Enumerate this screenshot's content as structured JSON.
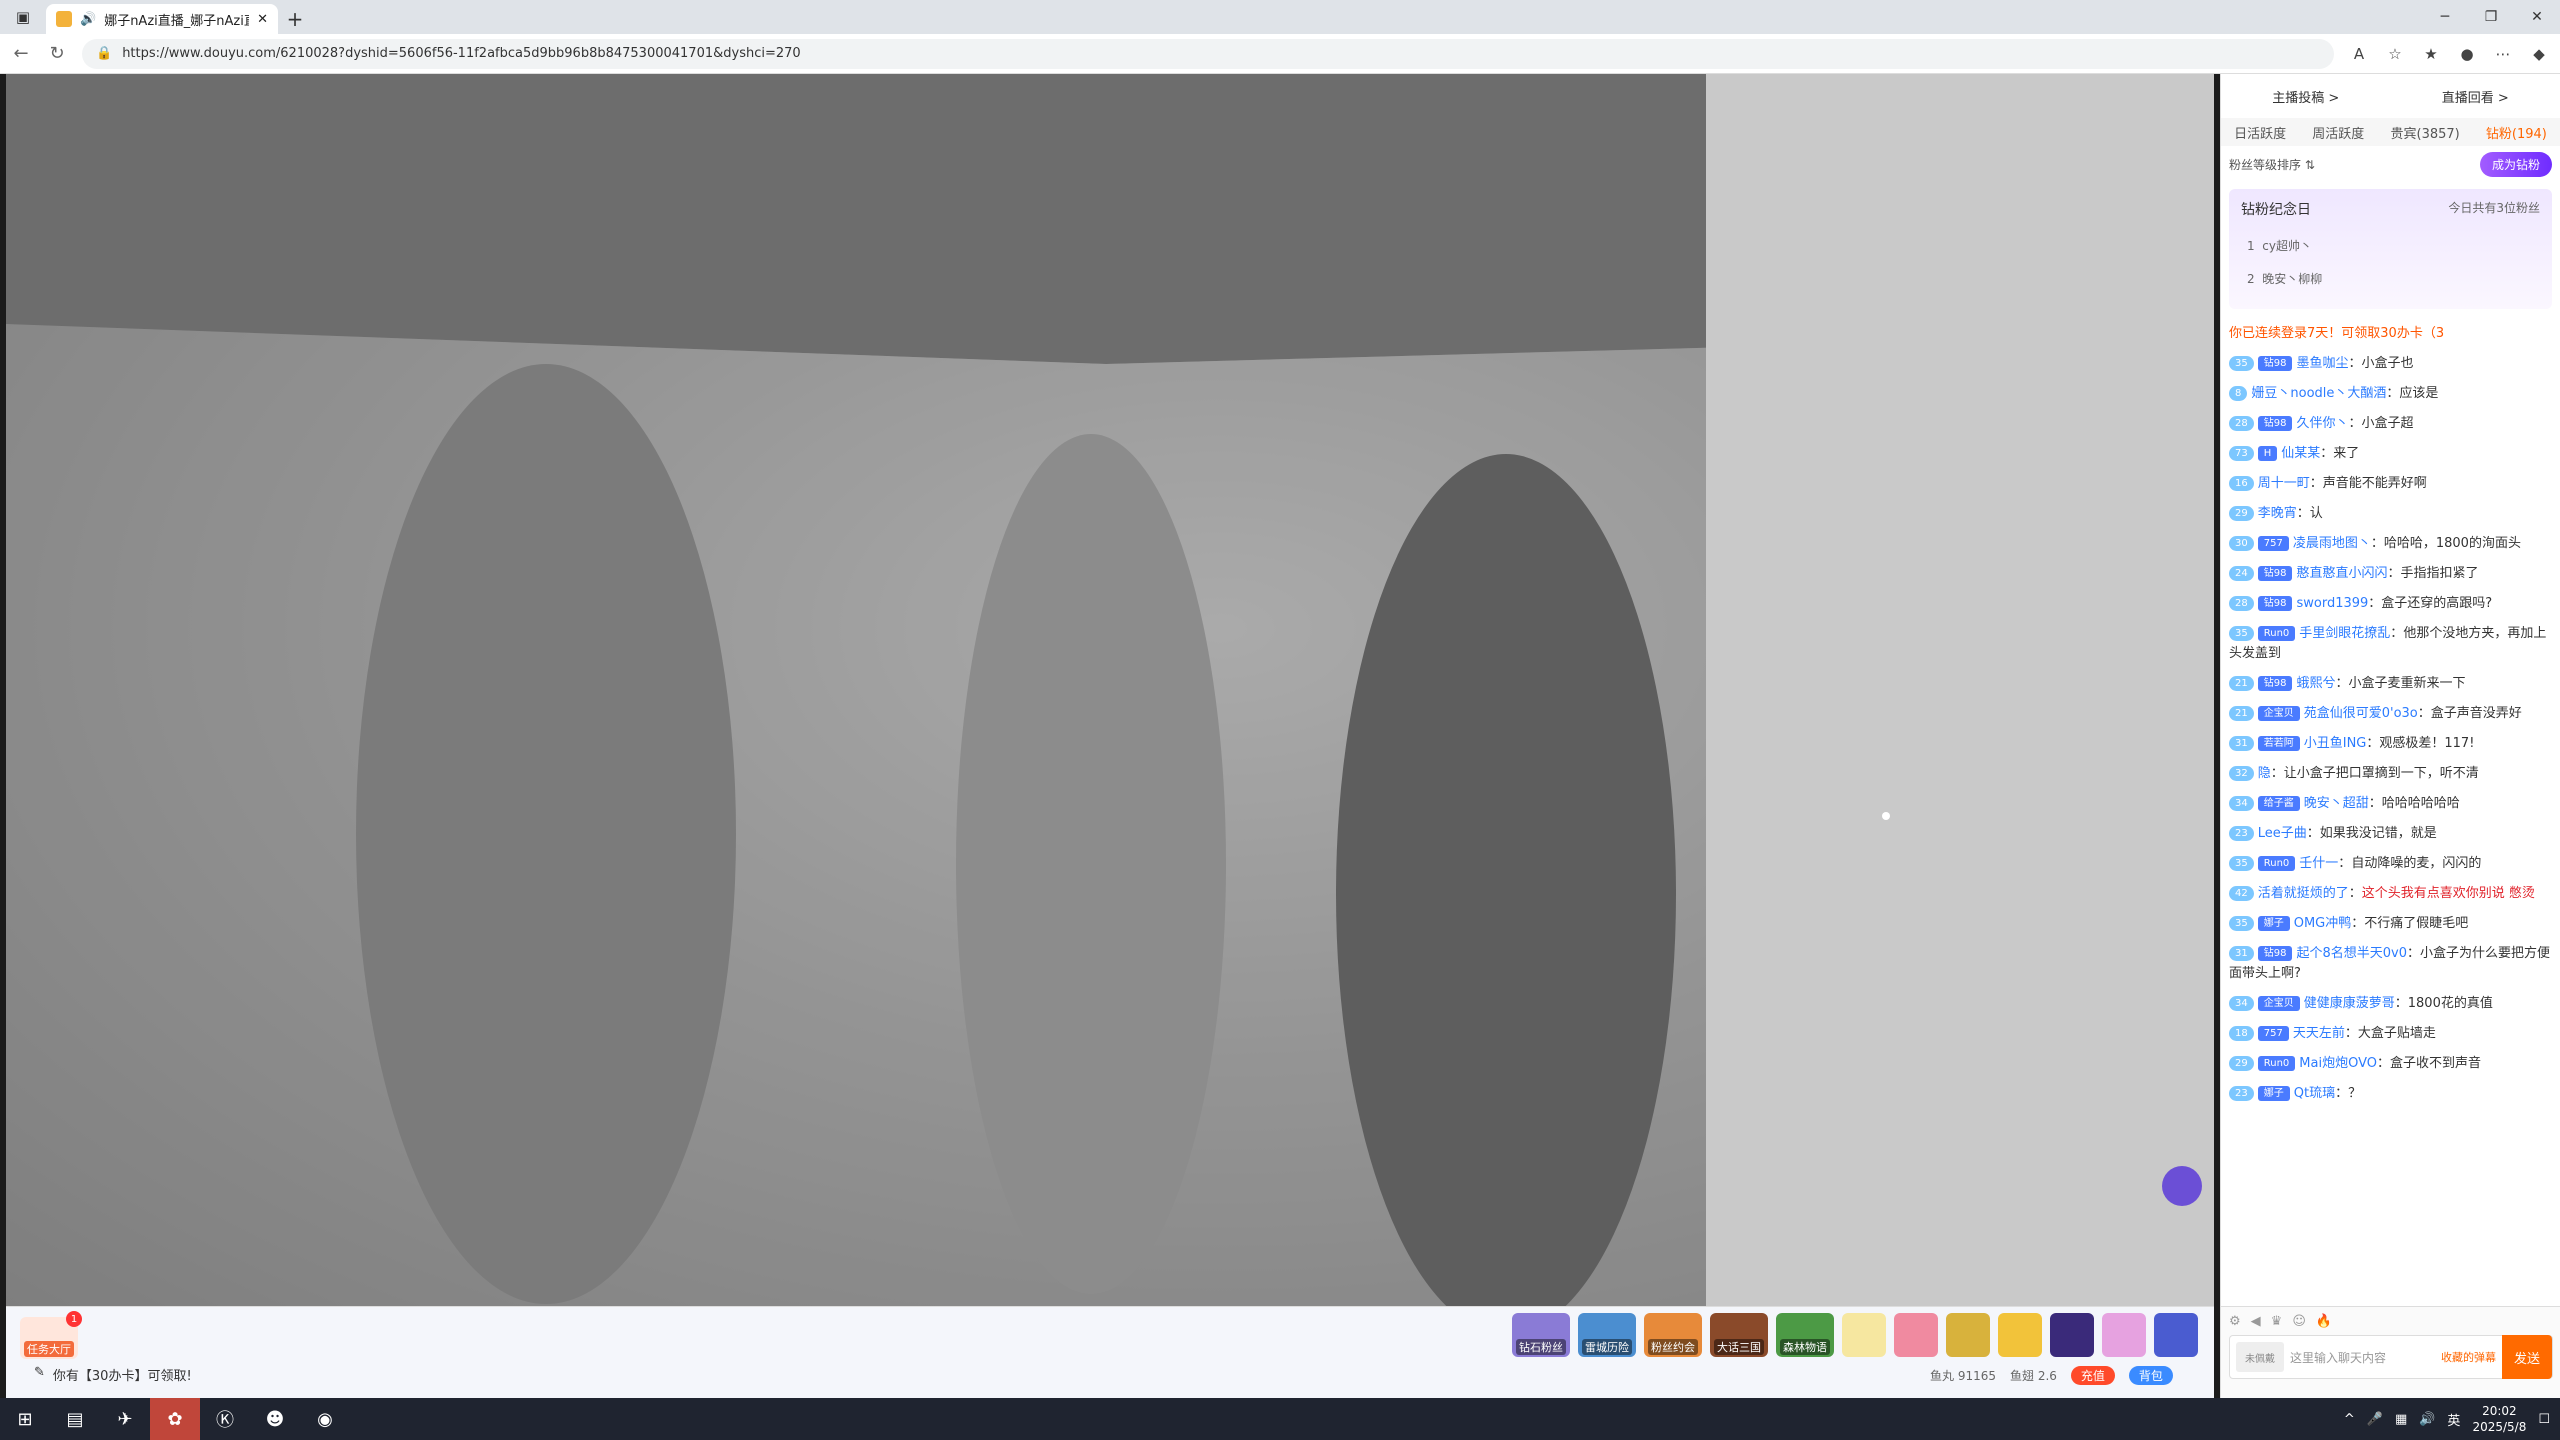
{
  "browser": {
    "tab_title": "娜子nAzi直播_娜子nAzi直播",
    "url": "https://www.douyu.com/6210028?dyshid=5606f56-11f2afbca5d9bb96b8b8475300041701&dyshci=270"
  },
  "aside": {
    "top_links": [
      "主播投稿 >",
      "直播回看 >"
    ],
    "tabs": [
      "日活跃度",
      "周活跃度",
      "贵宾(3857)",
      "钻粉(194)"
    ],
    "sort_label": "粉丝等级排序 ⇅",
    "vip_button": "成为钻粉",
    "anniv_title": "钻粉纪念日",
    "anniv_count": "今日共有3位粉丝",
    "rank": [
      {
        "n": "1",
        "name": "cy超帅丶"
      },
      {
        "n": "2",
        "name": "晚安丶柳柳"
      }
    ]
  },
  "chat": {
    "system": "你已连续登录7天！可领取30办卡（3",
    "messages": [
      {
        "lv": "35",
        "fan": "钻98",
        "name": "墨鱼咖尘",
        "text": "小盒子也"
      },
      {
        "lv": "8",
        "fan": "",
        "name": "姗豆丶noodle丶大酗酒",
        "text": "应该是"
      },
      {
        "lv": "28",
        "fan": "钻98",
        "name": "久伴你丶",
        "text": "小盒子超"
      },
      {
        "lv": "73",
        "fan": "H",
        "name": "仙某某",
        "text": "来了"
      },
      {
        "lv": "16",
        "fan": "",
        "name": "周十一町",
        "text": "声音能不能弄好啊"
      },
      {
        "lv": "29",
        "fan": "",
        "name": "李晚宵",
        "text": "认"
      },
      {
        "lv": "30",
        "fan": "757",
        "name": "凌晨雨地图丶",
        "text": "哈哈哈，1800的洵面头"
      },
      {
        "lv": "24",
        "fan": "钻98",
        "name": "憨直憨直小闪闪",
        "text": "手指指扣紧了"
      },
      {
        "lv": "28",
        "fan": "钻98",
        "name": "sword1399",
        "text": "盒子还穿的高跟吗?"
      },
      {
        "lv": "35",
        "fan": "Run0",
        "name": "手里剑眼花撩乱",
        "text": "他那个没地方夹，再加上头发盖到"
      },
      {
        "lv": "21",
        "fan": "钻98",
        "name": "蛾熙兮",
        "text": "小盒子麦重新来一下"
      },
      {
        "lv": "21",
        "fan": "企宝贝",
        "name": "苑盒仙很可爱0'o3o",
        "text": "盒子声音没弄好"
      },
      {
        "lv": "31",
        "fan": "若若阿",
        "name": "小丑鱼ING",
        "text": "观感极差！117!"
      },
      {
        "lv": "32",
        "fan": "",
        "name": "隐",
        "text": "让小盒子把口罩摘到一下，听不清"
      },
      {
        "lv": "34",
        "fan": "给子酱",
        "name": "晚安丶超甜",
        "text": "哈哈哈哈哈哈"
      },
      {
        "lv": "23",
        "fan": "",
        "name": "Lee子曲",
        "text": "如果我没记错，就是"
      },
      {
        "lv": "35",
        "fan": "Run0",
        "name": "壬什一",
        "text": "自动降噪的麦，闪闪的"
      },
      {
        "lv": "42",
        "fan": "",
        "name": "活着就挺烦的了",
        "text": "这个头我有点喜欢你别说 憋烫",
        "red": true
      },
      {
        "lv": "35",
        "fan": "娜子",
        "name": "OMG冲鸭",
        "text": "不行痛了假睫毛吧"
      },
      {
        "lv": "31",
        "fan": "钻98",
        "name": "起个8名想半天0v0",
        "text": "小盒子为什么要把方便面带头上啊?"
      },
      {
        "lv": "34",
        "fan": "企宝贝",
        "name": "健健康康菠萝哥",
        "text": "1800花的真值"
      },
      {
        "lv": "18",
        "fan": "757",
        "name": "天天左前",
        "text": "大盒子贴墙走"
      },
      {
        "lv": "29",
        "fan": "Run0",
        "name": "Mai炮炮OVO",
        "text": "盒子收不到声音"
      },
      {
        "lv": "23",
        "fan": "娜子",
        "name": "Qt琉璃",
        "text": "？"
      }
    ]
  },
  "input": {
    "placeholder": "这里输入聊天内容",
    "label": "未佩戴",
    "send": "发送",
    "extra": "收藏的弹幕"
  },
  "bottom": {
    "task": "任务大厅",
    "task_badge": "1",
    "card_text": "你有【30办卡】可领取!",
    "gifts": [
      "钻石粉丝",
      "雷城历险",
      "粉丝约会",
      "大话三国",
      "森林物语"
    ],
    "fish_ball": "鱼丸 91165",
    "fish_wing": "鱼翅 2.6",
    "recharge": "充值",
    "backpack": "背包"
  },
  "taskbar": {
    "time": "20:02",
    "date": "2025/5/8",
    "lang": "英"
  }
}
